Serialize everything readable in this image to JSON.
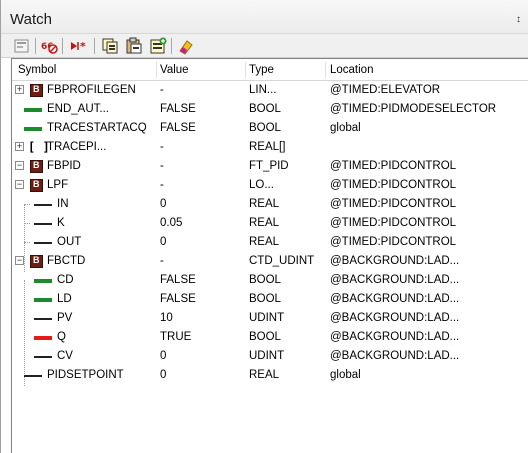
{
  "window": {
    "title": "Watch",
    "pin_glyph": "↕"
  },
  "toolbar": {
    "icons": [
      "properties-icon",
      "remove-watch-icon",
      "run-to-icon",
      "copy-icon",
      "paste-icon",
      "add-icon",
      "clear-icon"
    ]
  },
  "columns": {
    "symbol": "Symbol",
    "value": "Value",
    "type": "Type",
    "location": "Location"
  },
  "rows": [
    {
      "symbol": "FBPROFILEGEN",
      "value": "-",
      "type": "LIN...",
      "location": "@TIMED:ELEVATOR"
    },
    {
      "symbol": "END_AUT...",
      "value": "FALSE",
      "type": "BOOL",
      "location": "@TIMED:PIDMODESELECTOR"
    },
    {
      "symbol": "TRACESTARTACQ",
      "value": "FALSE",
      "type": "BOOL",
      "location": "global"
    },
    {
      "symbol": "TRACEPI...",
      "value": "-",
      "type": "REAL[]",
      "location": ""
    },
    {
      "symbol": "FBPID",
      "value": "-",
      "type": "FT_PID",
      "location": "@TIMED:PIDCONTROL"
    },
    {
      "symbol": "LPF",
      "value": "-",
      "type": "LO...",
      "location": "@TIMED:PIDCONTROL"
    },
    {
      "symbol": "IN",
      "value": "0",
      "type": "REAL",
      "location": "@TIMED:PIDCONTROL"
    },
    {
      "symbol": "K",
      "value": "0.05",
      "type": "REAL",
      "location": "@TIMED:PIDCONTROL"
    },
    {
      "symbol": "OUT",
      "value": "0",
      "type": "REAL",
      "location": "@TIMED:PIDCONTROL"
    },
    {
      "symbol": "FBCTD",
      "value": "-",
      "type": "CTD_UDINT",
      "location": "@BACKGROUND:LAD..."
    },
    {
      "symbol": "CD",
      "value": "FALSE",
      "type": "BOOL",
      "location": "@BACKGROUND:LAD..."
    },
    {
      "symbol": "LD",
      "value": "FALSE",
      "type": "BOOL",
      "location": "@BACKGROUND:LAD..."
    },
    {
      "symbol": "PV",
      "value": "10",
      "type": "UDINT",
      "location": "@BACKGROUND:LAD..."
    },
    {
      "symbol": "Q",
      "value": "TRUE",
      "type": "BOOL",
      "location": "@BACKGROUND:LAD..."
    },
    {
      "symbol": "CV",
      "value": "0",
      "type": "UDINT",
      "location": "@BACKGROUND:LAD..."
    },
    {
      "symbol": "PIDSETPOINT",
      "value": "0",
      "type": "REAL",
      "location": "global"
    }
  ],
  "expanders": [
    "+",
    "+",
    "−",
    "−"
  ],
  "array_glyph": "[ ]",
  "colors": {
    "bool_false": "#1e8a2e",
    "bool_true": "#e51a1a",
    "function_block": "#6b1f14"
  }
}
